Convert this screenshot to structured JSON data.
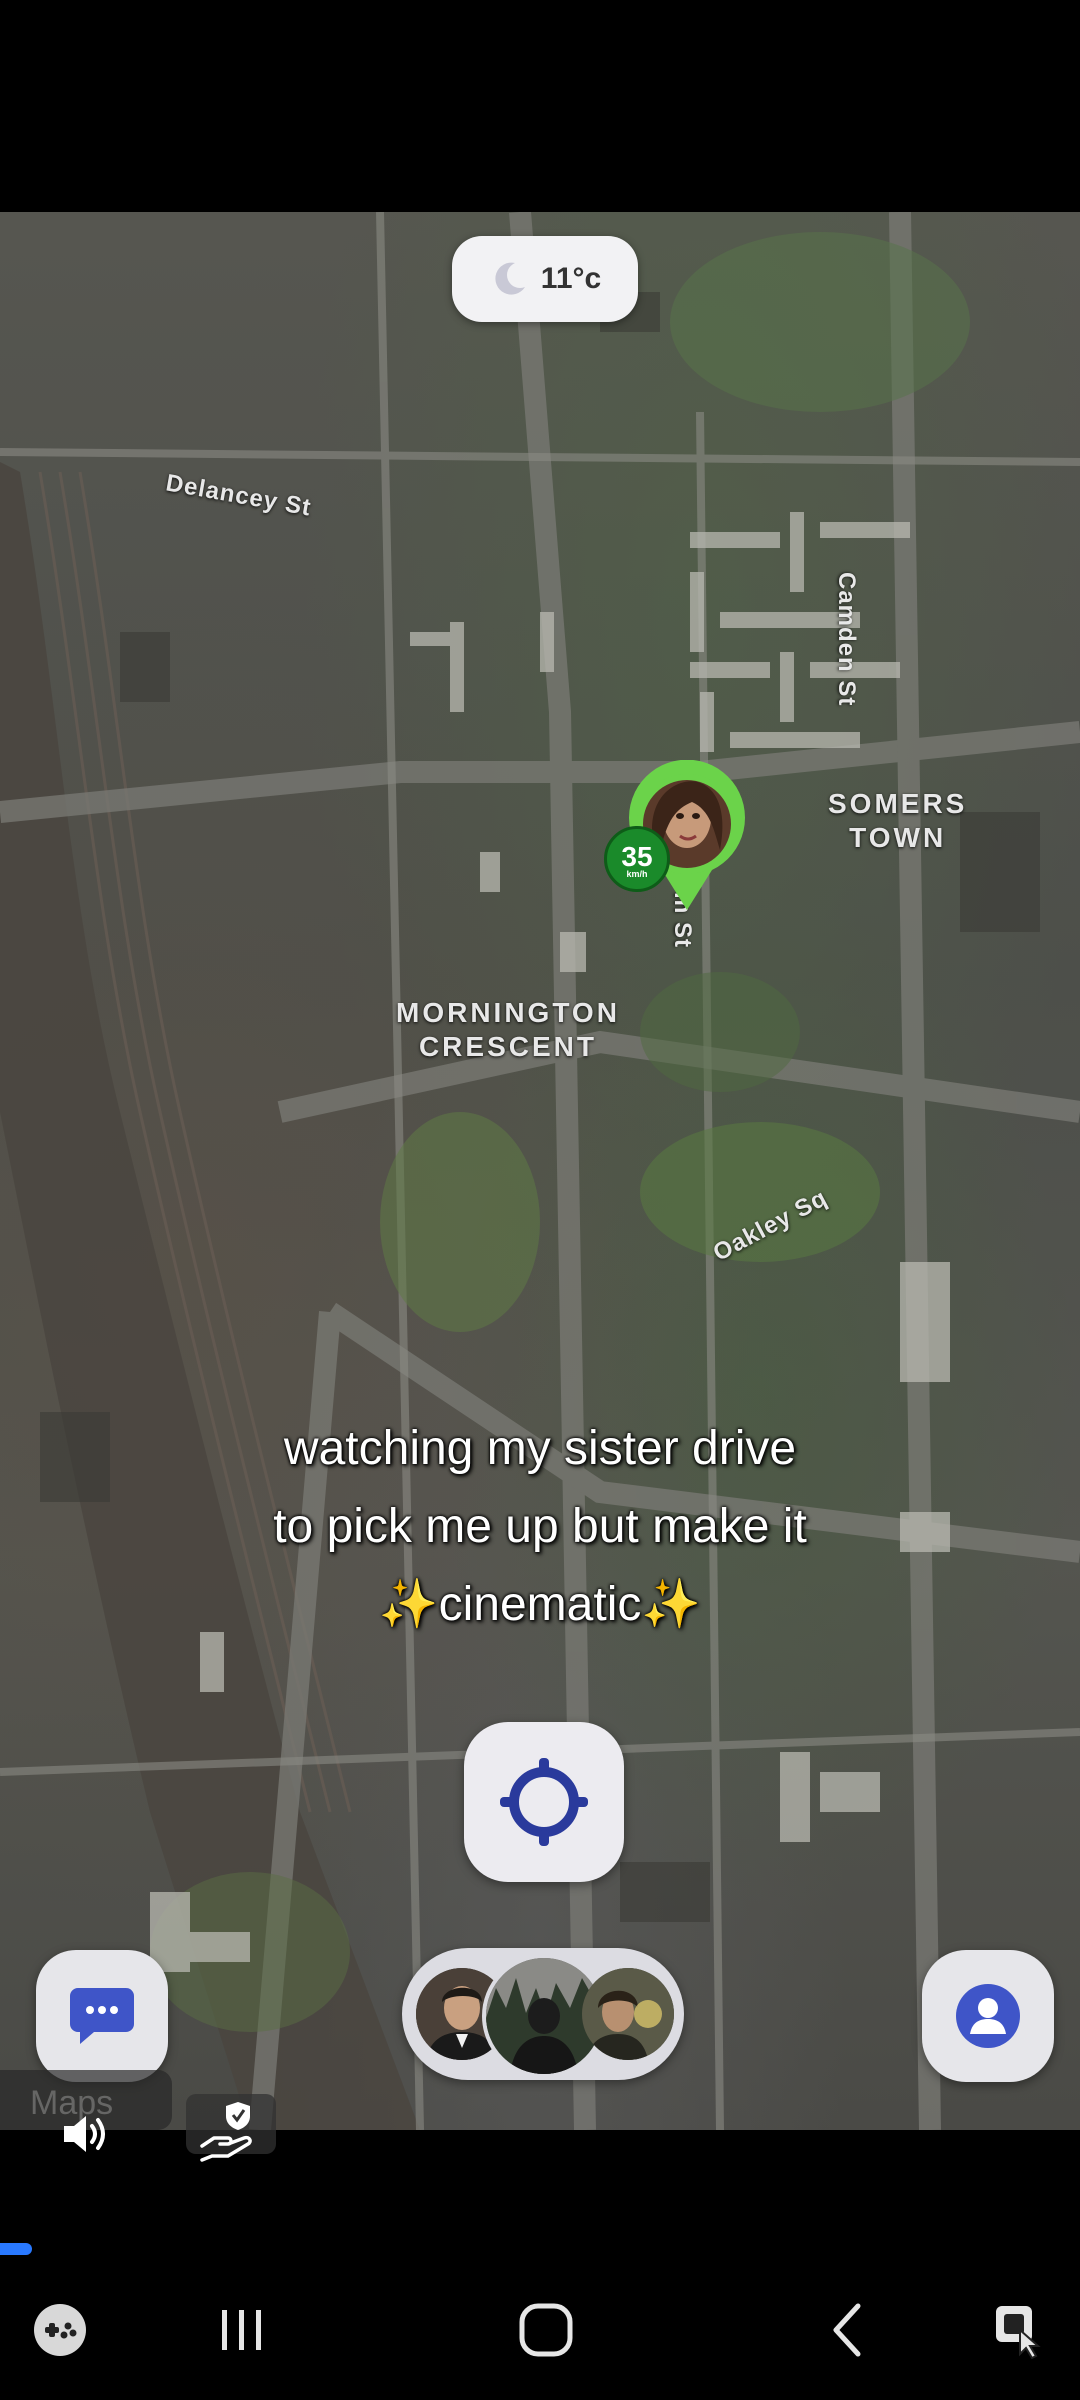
{
  "weather": {
    "temperature": "11°c",
    "icon": "moon-icon"
  },
  "map": {
    "streets": {
      "delancey": "Delancey St",
      "camden": "Camden St",
      "oakley": "Oakley Sq",
      "partial": "m St"
    },
    "areas": {
      "somers_town_1": "SOMERS",
      "somers_town_2": "TOWN",
      "mornington_1": "MORNINGTON",
      "mornington_2": "CRESCENT"
    },
    "friend_pin": {
      "speed": "35",
      "speed_unit": "km/h"
    }
  },
  "caption": {
    "line1": "watching my sister drive",
    "line2": "to pick me up but make it",
    "line3_prefix": "✨",
    "line3_word": "cinematic",
    "line3_suffix": "✨"
  },
  "controls": {
    "recenter_icon": "location-target-icon",
    "chat_icon": "chat-bubble-icon",
    "profile_icon": "person-icon",
    "watermark": "Maps"
  },
  "video": {
    "progress": 0.03
  },
  "nav_bar": {
    "icons": [
      "game-launcher-icon",
      "recent-apps-icon",
      "home-icon",
      "back-icon",
      "screen-assist-icon"
    ]
  },
  "colors": {
    "accent_blue": "#2979ff",
    "icon_blue": "#2a3a9c",
    "speed_green": "#1a8a2a"
  }
}
